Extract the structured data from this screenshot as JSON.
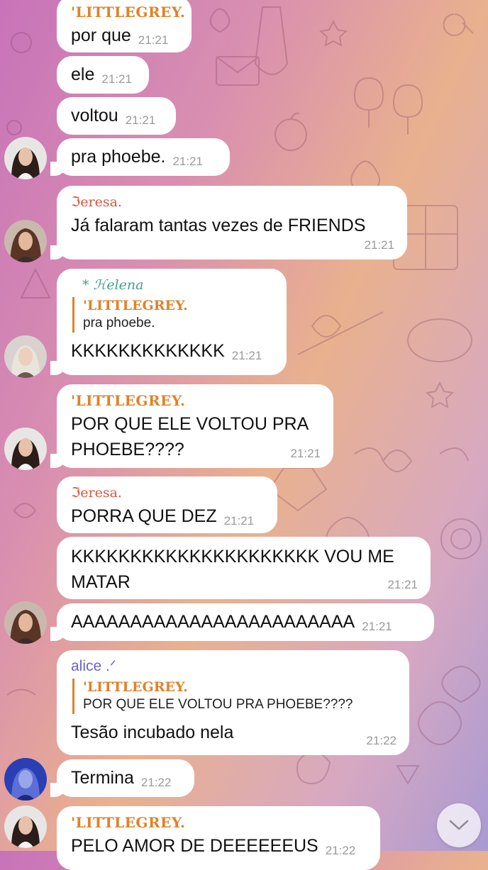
{
  "messages": [
    {
      "sender": "'LITTLEGREY.",
      "text": "por que",
      "time": "21:21"
    },
    {
      "text": "ele",
      "time": "21:21"
    },
    {
      "text": "voltou",
      "time": "21:21"
    },
    {
      "text": "pra phoebe.",
      "time": "21:21"
    },
    {
      "sender": "ℑeresa.",
      "text": "Já falaram tantas vezes de FRIENDS",
      "time": "21:21"
    },
    {
      "sender": "* ℋelena",
      "reply_name": "'LITTLEGREY.",
      "reply_text": "pra phoebe.",
      "text": "KKKKKKKKKKKKK",
      "time": "21:21"
    },
    {
      "sender": "'LITTLEGREY.",
      "text": "POR QUE ELE VOLTOU PRA\nPHOEBE????",
      "time": "21:21"
    },
    {
      "sender": "ℑeresa.",
      "text": "PORRA QUE DEZ",
      "time": "21:21"
    },
    {
      "text": "KKKKKKKKKKKKKKKKKKKKK VOU ME\nMATAR",
      "time": "21:21"
    },
    {
      "text": "AAAAAAAAAAAAAAAAAAAAAAAA",
      "time": "21:21"
    },
    {
      "sender": "alice .ᐟ",
      "reply_name": "'LITTLEGREY.",
      "reply_text": "POR QUE ELE VOLTOU PRA PHOEBE????",
      "text": "Tesão incubado nela",
      "time": "21:22"
    },
    {
      "text": "Termina",
      "time": "21:22"
    },
    {
      "sender": "'LITTLEGREY.",
      "text": "PELO AMOR DE DEEEEEEUS",
      "time": "21:22"
    }
  ],
  "colors": {
    "littlegrey": "#e0822a",
    "teresa": "#d9553f",
    "helena": "#3fa08a",
    "alice": "#6b63c9",
    "bubble": "#ffffff"
  },
  "icons": {
    "scroll_down": "chevron-down-icon"
  }
}
